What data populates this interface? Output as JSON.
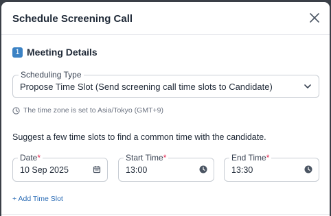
{
  "modal": {
    "title": "Schedule Screening Call"
  },
  "section": {
    "number": "1",
    "title": "Meeting Details"
  },
  "scheduling_type": {
    "label": "Scheduling Type",
    "value": "Propose Time Slot (Send screening call time slots to Candidate)"
  },
  "timezone_note": "The time zone is set to Asia/Tokyo (GMT+9)",
  "suggest_text": "Suggest a few time slots to find a common time with the candidate.",
  "fields": {
    "date": {
      "label": "Date",
      "required": "*",
      "value": "10 Sep 2025"
    },
    "start": {
      "label": "Start Time",
      "required": "*",
      "value": "13:00"
    },
    "end": {
      "label": "End Time",
      "required": "*",
      "value": "13:30"
    }
  },
  "add_slot_label": "+ Add Time Slot",
  "icons": {
    "close": "close-icon",
    "chevron": "chevron-down-icon",
    "clock": "clock-icon",
    "calendar": "calendar-icon"
  },
  "colors": {
    "accent": "#3b82c4",
    "link": "#2f6fb7",
    "required": "#e11d48"
  }
}
